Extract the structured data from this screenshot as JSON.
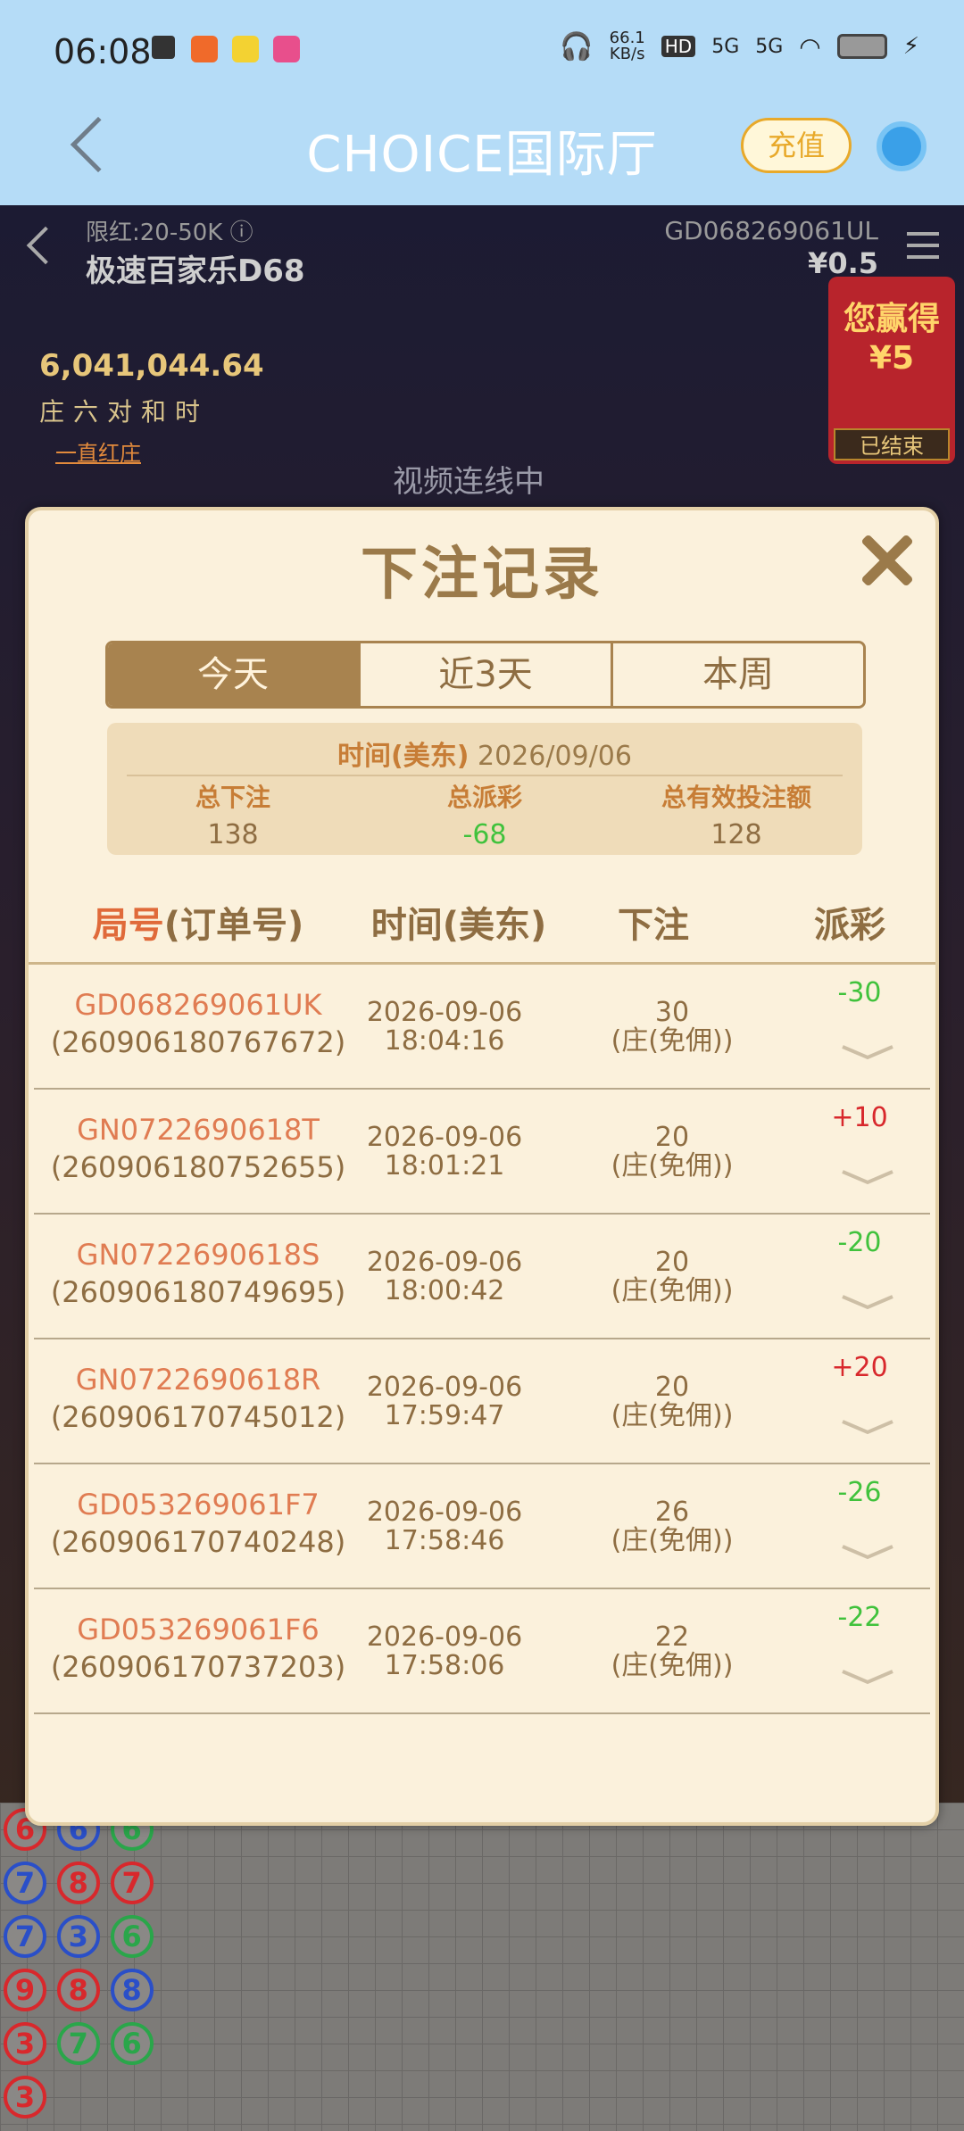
{
  "status_bar": {
    "time": "06:08",
    "net_speed": "66.1",
    "net_unit": "KB/s",
    "signal1": "5G",
    "signal2": "5G"
  },
  "app_header": {
    "title": "CHOICE国际厅",
    "recharge_label": "充值",
    "back_icon": "chevron-left-icon",
    "service_icon": "customer-service-icon"
  },
  "game": {
    "limit": "限红:20-50K ⓘ",
    "table_name": "极速百家乐D68",
    "round_id": "GD068269061UL",
    "balance": "¥0.5",
    "jackpot": "6,041,044.64",
    "roads": "庄六对和时",
    "red_link": "一直红庄",
    "video_status": "视频连线中",
    "win_label": "您赢得",
    "win_amount": "¥5",
    "ended": "已结束"
  },
  "modal": {
    "title": "下注记录",
    "tabs": [
      "今天",
      "近3天",
      "本周"
    ],
    "active_tab": 0,
    "summary": {
      "date_label": "时间(美东)",
      "date_value": "2026/09/06",
      "total_bet_label": "总下注",
      "total_bet": "138",
      "total_payout_label": "总派彩",
      "total_payout": "-68",
      "total_valid_label": "总有效投注额",
      "total_valid": "128"
    },
    "columns": {
      "id_hl": "局号",
      "id_rest": "(订单号)",
      "time": "时间(美东)",
      "bet": "下注",
      "payout": "派彩"
    },
    "rows": [
      {
        "id": "GD068269061UK",
        "order": "(260906180767672)",
        "date": "2026-09-06",
        "time": "18:04:16",
        "amount": "30",
        "bet_type": "(庄(免佣))",
        "payout": "-30",
        "positive": false
      },
      {
        "id": "GN0722690618T",
        "order": "(260906180752655)",
        "date": "2026-09-06",
        "time": "18:01:21",
        "amount": "20",
        "bet_type": "(庄(免佣))",
        "payout": "+10",
        "positive": true
      },
      {
        "id": "GN0722690618S",
        "order": "(260906180749695)",
        "date": "2026-09-06",
        "time": "18:00:42",
        "amount": "20",
        "bet_type": "(庄(免佣))",
        "payout": "-20",
        "positive": false
      },
      {
        "id": "GN0722690618R",
        "order": "(260906170745012)",
        "date": "2026-09-06",
        "time": "17:59:47",
        "amount": "20",
        "bet_type": "(庄(免佣))",
        "payout": "+20",
        "positive": true
      },
      {
        "id": "GD053269061F7",
        "order": "(260906170740248)",
        "date": "2026-09-06",
        "time": "17:58:46",
        "amount": "26",
        "bet_type": "(庄(免佣))",
        "payout": "-26",
        "positive": false
      },
      {
        "id": "GD053269061F6",
        "order": "(260906170737203)",
        "date": "2026-09-06",
        "time": "17:58:06",
        "amount": "22",
        "bet_type": "(庄(免佣))",
        "payout": "-22",
        "positive": false
      }
    ]
  },
  "colors": {
    "header_bg": "#b5dcf7",
    "modal_bg": "#fbf1dc",
    "tab_active": "#a8834f",
    "payout_negative": "#40c23c",
    "payout_positive": "#d8282c",
    "id_color": "#e07c52"
  },
  "beads": [
    "6",
    "6",
    "6",
    "7",
    "8",
    "7",
    "7",
    "3",
    "6",
    "9",
    "8",
    "8",
    "3",
    "7",
    "6",
    "3"
  ]
}
